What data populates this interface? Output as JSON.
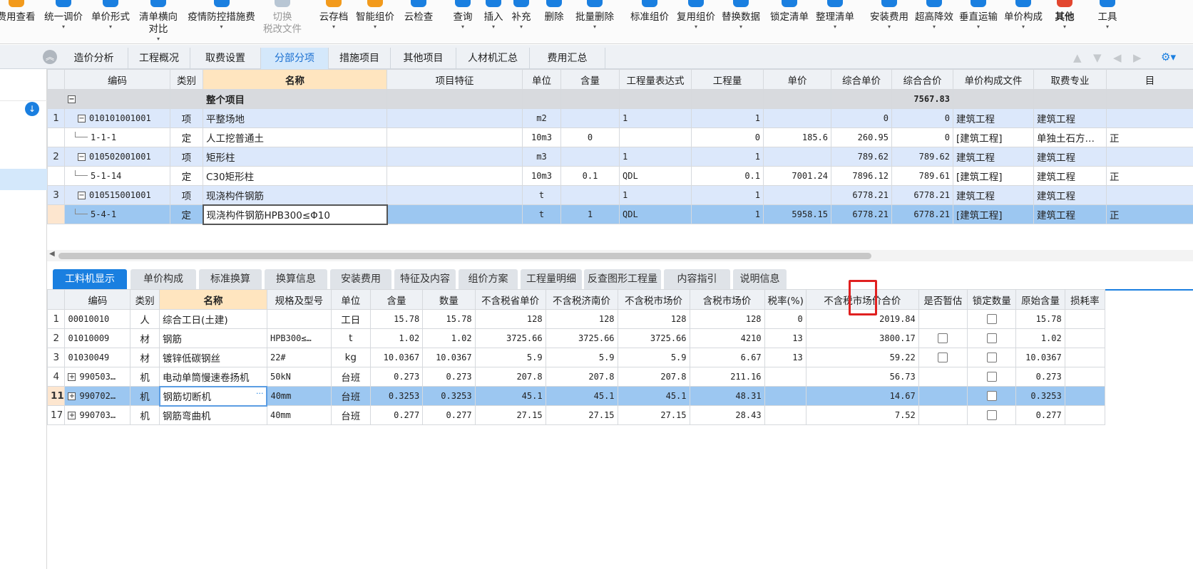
{
  "toolbar": {
    "buttons": [
      {
        "label": "费用查看",
        "dropdown": false
      },
      {
        "label": "统一调价",
        "dropdown": true
      },
      {
        "label": "单价形式",
        "dropdown": true
      },
      {
        "label": "清单横向",
        "label2": "对比",
        "dropdown": true
      },
      {
        "label": "疫情防控措施费",
        "dropdown": true
      },
      {
        "label": "切换",
        "label2": "税改文件",
        "disabled": true
      },
      {
        "label": "云存档",
        "dropdown": true
      },
      {
        "label": "智能组价",
        "dropdown": true
      },
      {
        "label": "云检查",
        "dropdown": false
      },
      {
        "label": "查询",
        "dropdown": true
      },
      {
        "label": "插入",
        "dropdown": true
      },
      {
        "label": "补充",
        "dropdown": true
      },
      {
        "label": "删除",
        "dropdown": false
      },
      {
        "label": "批量删除",
        "dropdown": true
      },
      {
        "label": "标准组价",
        "dropdown": false
      },
      {
        "label": "复用组价",
        "dropdown": true
      },
      {
        "label": "替换数据",
        "dropdown": true
      },
      {
        "label": "锁定清单",
        "dropdown": false
      },
      {
        "label": "整理清单",
        "dropdown": true
      },
      {
        "label": "安装费用",
        "dropdown": true
      },
      {
        "label": "超高降效",
        "dropdown": true
      },
      {
        "label": "垂直运输",
        "dropdown": true
      },
      {
        "label": "单价构成",
        "dropdown": true
      },
      {
        "label": "其他",
        "dropdown": true
      },
      {
        "label": "工具",
        "dropdown": true
      }
    ]
  },
  "main_tabs": [
    "造价分析",
    "工程概况",
    "取费设置",
    "分部分项",
    "措施项目",
    "其他项目",
    "人材机汇总",
    "费用汇总"
  ],
  "main_tab_active": "分部分项",
  "top_grid": {
    "headers": [
      "",
      "编码",
      "类别",
      "名称",
      "项目特征",
      "单位",
      "含量",
      "工程量表达式",
      "工程量",
      "单价",
      "综合单价",
      "综合合价",
      "单价构成文件",
      "取费专业",
      "目"
    ],
    "total_row": {
      "name": "整个项目",
      "total": "7567.83"
    },
    "rows": [
      {
        "idx": "1",
        "code": "010101001001",
        "type": "项",
        "name": "平整场地",
        "feature": "",
        "unit": "m2",
        "content": "",
        "expr": "1",
        "qty": "1",
        "price": "",
        "unit_price": "0",
        "total": "0",
        "file": "建筑工程",
        "major": "建筑工程",
        "extra": "",
        "kind": "qd"
      },
      {
        "idx": "",
        "code": "1-1-1",
        "type": "定",
        "name": "人工挖普通土",
        "feature": "",
        "unit": "10m3",
        "content": "0",
        "expr": "",
        "qty": "0",
        "price": "185.6",
        "unit_price": "260.95",
        "total": "0",
        "file": "[建筑工程]",
        "major": "单独土石方…",
        "extra": "正",
        "kind": "de"
      },
      {
        "idx": "2",
        "code": "010502001001",
        "type": "项",
        "name": "矩形柱",
        "feature": "",
        "unit": "m3",
        "content": "",
        "expr": "1",
        "qty": "1",
        "price": "",
        "unit_price": "789.62",
        "total": "789.62",
        "file": "建筑工程",
        "major": "建筑工程",
        "extra": "",
        "kind": "qd"
      },
      {
        "idx": "",
        "code": "5-1-14",
        "type": "定",
        "name": "C30矩形柱",
        "feature": "",
        "unit": "10m3",
        "content": "0.1",
        "expr": "QDL",
        "qty": "0.1",
        "price": "7001.24",
        "unit_price": "7896.12",
        "total": "789.61",
        "file": "[建筑工程]",
        "major": "建筑工程",
        "extra": "正",
        "kind": "de"
      },
      {
        "idx": "3",
        "code": "010515001001",
        "type": "项",
        "name": "现浇构件钢筋",
        "feature": "",
        "unit": "t",
        "content": "",
        "expr": "1",
        "qty": "1",
        "price": "",
        "unit_price": "6778.21",
        "total": "6778.21",
        "file": "建筑工程",
        "major": "建筑工程",
        "extra": "",
        "kind": "qd"
      },
      {
        "idx": "",
        "code": "5-4-1",
        "type": "定",
        "name": "现浇构件钢筋HPB300≤Φ10",
        "feature": "",
        "unit": "t",
        "content": "1",
        "expr": "QDL",
        "qty": "1",
        "price": "5958.15",
        "unit_price": "6778.21",
        "total": "6778.21",
        "file": "[建筑工程]",
        "major": "建筑工程",
        "extra": "正",
        "kind": "sel"
      }
    ]
  },
  "bottom_tabs": [
    "工料机显示",
    "单价构成",
    "标准换算",
    "换算信息",
    "安装费用",
    "特征及内容",
    "组价方案",
    "工程量明细",
    "反查图形工程量",
    "内容指引",
    "说明信息"
  ],
  "bottom_tab_active": "工料机显示",
  "bottom_grid": {
    "headers": [
      "",
      "编码",
      "类别",
      "名称",
      "规格及型号",
      "单位",
      "含量",
      "数量",
      "不含税省单价",
      "不含税济南价",
      "不含税市场价",
      "含税市场价",
      "税率(%)",
      "不含税市场价合价",
      "是否暂估",
      "锁定数量",
      "原始含量",
      "损耗率"
    ],
    "rows": [
      {
        "idx": "1",
        "expand": false,
        "code": "00010010",
        "type": "人",
        "name": "综合工日(土建)",
        "spec": "",
        "unit": "工日",
        "content": "15.78",
        "qty": "15.78",
        "prov": "128",
        "jinan": "128",
        "market": "128",
        "market_tax": "128",
        "rate": "0",
        "total": "2019.84",
        "est": false,
        "lock": true,
        "orig": "15.78",
        "loss": "",
        "selected": false
      },
      {
        "idx": "2",
        "expand": false,
        "code": "01010009",
        "type": "材",
        "name": "钢筋",
        "spec": "HPB300≤…",
        "unit": "t",
        "content": "1.02",
        "qty": "1.02",
        "prov": "3725.66",
        "jinan": "3725.66",
        "market": "3725.66",
        "market_tax": "4210",
        "rate": "13",
        "total": "3800.17",
        "est": true,
        "lock": true,
        "orig": "1.02",
        "loss": "",
        "selected": false
      },
      {
        "idx": "3",
        "expand": false,
        "code": "01030049",
        "type": "材",
        "name": "镀锌低碳钢丝",
        "spec": "22#",
        "unit": "kg",
        "content": "10.0367",
        "qty": "10.0367",
        "prov": "5.9",
        "jinan": "5.9",
        "market": "5.9",
        "market_tax": "6.67",
        "rate": "13",
        "total": "59.22",
        "est": true,
        "lock": true,
        "orig": "10.0367",
        "loss": "",
        "selected": false
      },
      {
        "idx": "4",
        "expand": true,
        "code": "990503…",
        "type": "机",
        "name": "电动单筒慢速卷扬机",
        "spec": "50kN",
        "unit": "台班",
        "content": "0.273",
        "qty": "0.273",
        "prov": "207.8",
        "jinan": "207.8",
        "market": "207.8",
        "market_tax": "211.16",
        "rate": "",
        "total": "56.73",
        "est": false,
        "lock": true,
        "orig": "0.273",
        "loss": "",
        "selected": false
      },
      {
        "idx": "11",
        "expand": true,
        "code": "990702…",
        "type": "机",
        "name": "钢筋切断机",
        "spec": "40mm",
        "unit": "台班",
        "content": "0.3253",
        "qty": "0.3253",
        "prov": "45.1",
        "jinan": "45.1",
        "market": "45.1",
        "market_tax": "48.31",
        "rate": "",
        "total": "14.67",
        "est": false,
        "lock": true,
        "orig": "0.3253",
        "loss": "",
        "selected": true
      },
      {
        "idx": "17",
        "expand": true,
        "code": "990703…",
        "type": "机",
        "name": "钢筋弯曲机",
        "spec": "40mm",
        "unit": "台班",
        "content": "0.277",
        "qty": "0.277",
        "prov": "27.15",
        "jinan": "27.15",
        "market": "27.15",
        "market_tax": "28.43",
        "rate": "",
        "total": "7.52",
        "est": false,
        "lock": true,
        "orig": "0.277",
        "loss": "",
        "selected": false
      }
    ]
  },
  "icons": {
    "collapse": "double-chevron-up-icon",
    "download": "download-arrow-icon",
    "settings": "column-settings-icon"
  },
  "colors": {
    "accent": "#1a7fe0",
    "selection": "#9cc7f1",
    "highlight_box": "#e02020"
  }
}
